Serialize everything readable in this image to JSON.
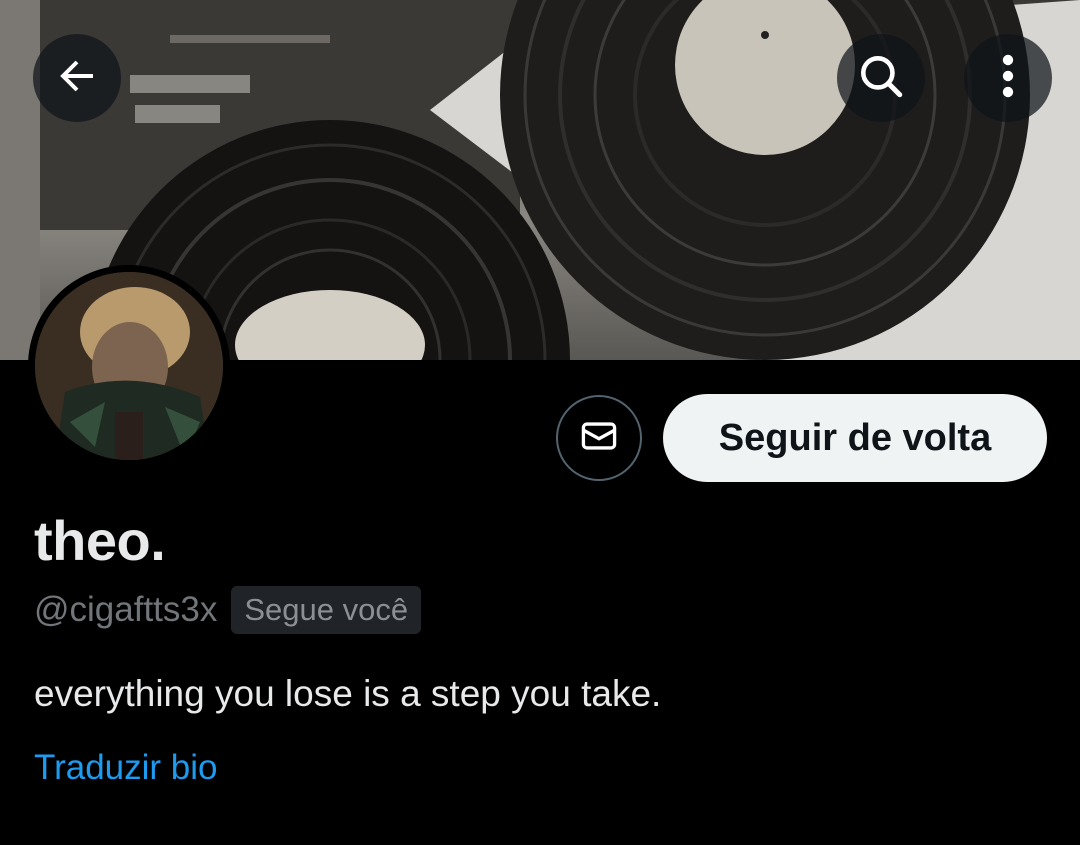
{
  "header": {
    "back_icon": "arrow-left-icon",
    "search_icon": "search-icon",
    "more_icon": "more-vertical-icon",
    "banner_image": "vinyl-records-photo"
  },
  "profile": {
    "avatar_image": "profile-avatar-photo",
    "name": "theo.",
    "handle": "@cigaftts3x",
    "follows_you_badge": "Segue você",
    "bio": "everything you lose is a step you take.",
    "translate_bio": "Traduzir bio"
  },
  "actions": {
    "message_icon": "envelope-icon",
    "follow_back_label": "Seguir de volta"
  },
  "colors": {
    "background": "#000000",
    "link": "#1d9bf0",
    "follow_button_bg": "#eff3f4",
    "muted_text": "#71767b"
  }
}
